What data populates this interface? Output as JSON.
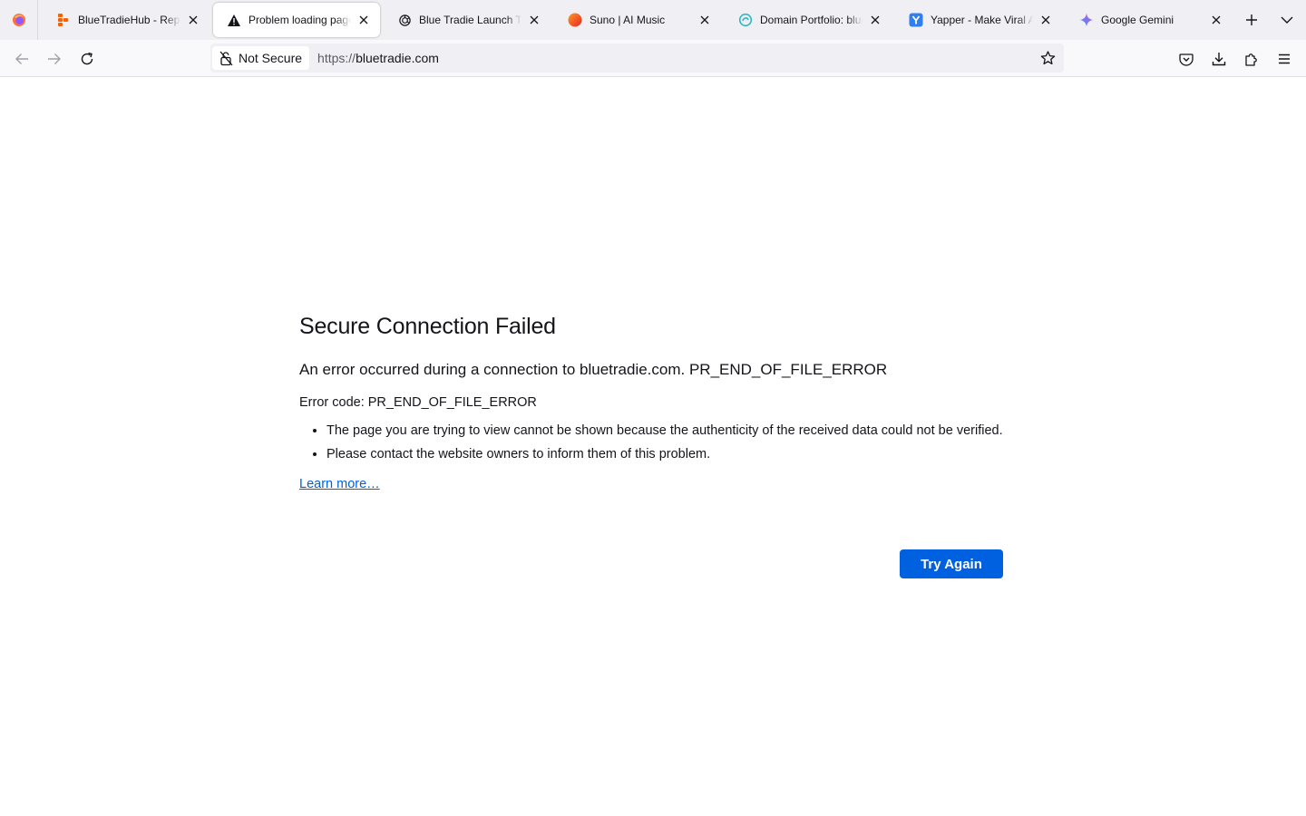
{
  "browser": {
    "tabs": [
      {
        "title": "BlueTradieHub - Replit",
        "icon": "replit-icon",
        "active": false
      },
      {
        "title": "Problem loading page",
        "icon": "warning-icon",
        "active": true
      },
      {
        "title": "Blue Tradie Launch Thread",
        "icon": "openai-icon",
        "active": false
      },
      {
        "title": "Suno | AI Music",
        "icon": "suno-icon",
        "active": false
      },
      {
        "title": "Domain Portfolio: bluetradie",
        "icon": "domain-portfolio-icon",
        "active": false
      },
      {
        "title": "Yapper - Make Viral AI Videos",
        "icon": "yapper-icon",
        "active": false
      },
      {
        "title": "Google Gemini",
        "icon": "gemini-icon",
        "active": false
      }
    ],
    "identity_label": "Not Secure",
    "url_scheme": "https://",
    "url_host": "bluetradie.com",
    "accent": "#0061e0"
  },
  "error_page": {
    "title": "Secure Connection Failed",
    "description": "An error occurred during a connection to bluetradie.com. PR_END_OF_FILE_ERROR",
    "error_code": "Error code: PR_END_OF_FILE_ERROR",
    "bullets": [
      "The page you are trying to view cannot be shown because the authenticity of the received data could not be verified.",
      "Please contact the website owners to inform them of this problem."
    ],
    "learn_more": "Learn more…",
    "try_again": "Try Again"
  }
}
